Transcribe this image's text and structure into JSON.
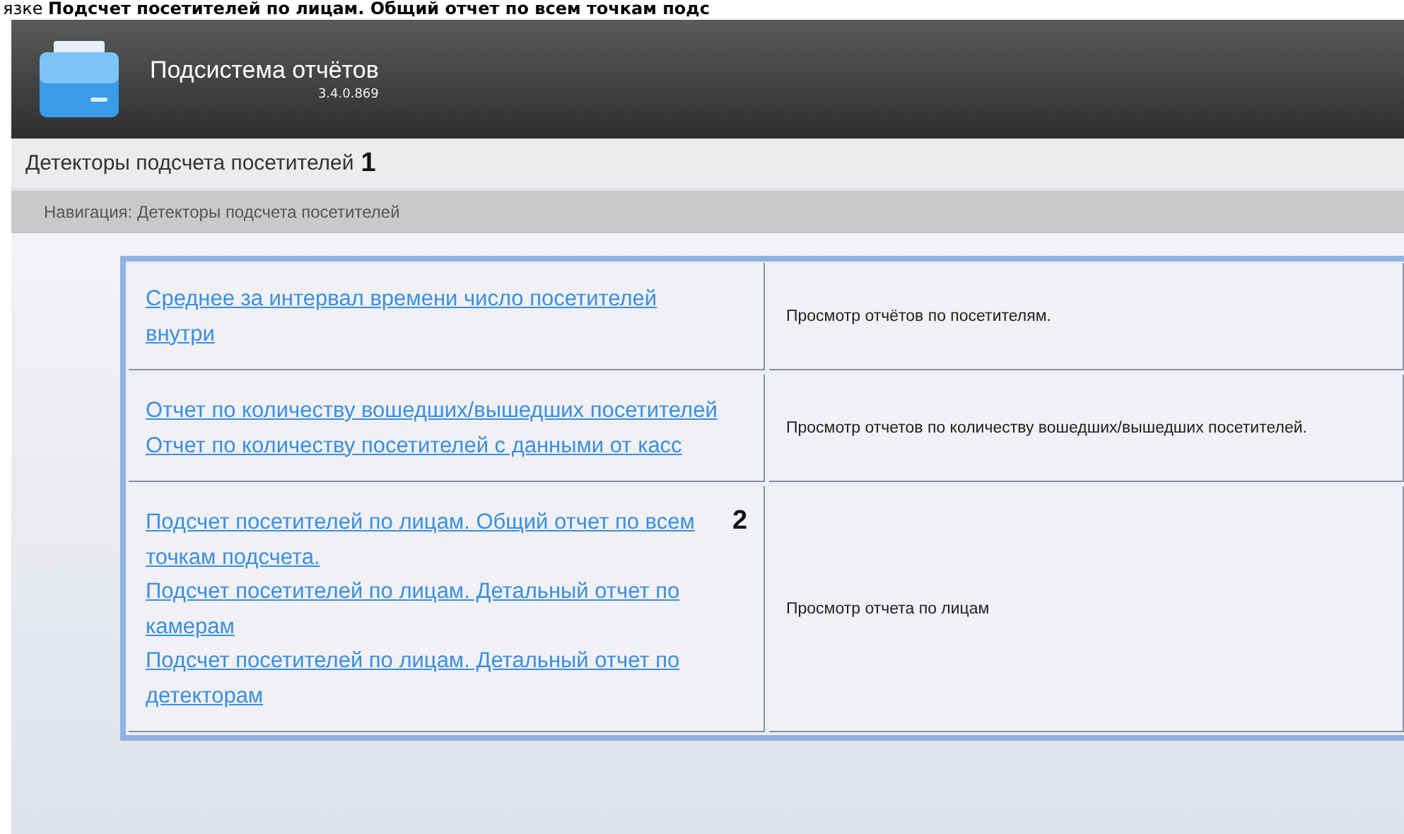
{
  "doc_caption": "язке **Подсчет посетителей по лицам. Общий отчет по всем точкам подс**",
  "header": {
    "title": "Подсистема отчётов",
    "version": "3.4.0.869"
  },
  "page_title": {
    "text": "Детекторы подсчета посетителей",
    "marker": "1"
  },
  "breadcrumb": "Навигация: Детекторы подсчета посетителей",
  "rows": [
    {
      "links": [
        {
          "text": "Среднее за интервал времени число посетителей внутри"
        }
      ],
      "description": "Просмотр отчётов по посетителям."
    },
    {
      "links": [
        {
          "text": "Отчет по количеству вошедших/вышедших посетителей"
        },
        {
          "text": "Отчет по количеству посетителей с данными от касс"
        }
      ],
      "description": "Просмотр отчетов по количеству вошедших/вышедших посетителей."
    },
    {
      "links": [
        {
          "text": "Подсчет посетителей по лицам. Общий отчет по всем точкам подсчета.",
          "marker": "2"
        },
        {
          "text": "Подсчет посетителей по лицам. Детальный отчет по камерам"
        },
        {
          "text": "Подсчет посетителей по лицам. Детальный отчет по детекторам"
        }
      ],
      "description": "Просмотр отчета по лицам"
    }
  ]
}
